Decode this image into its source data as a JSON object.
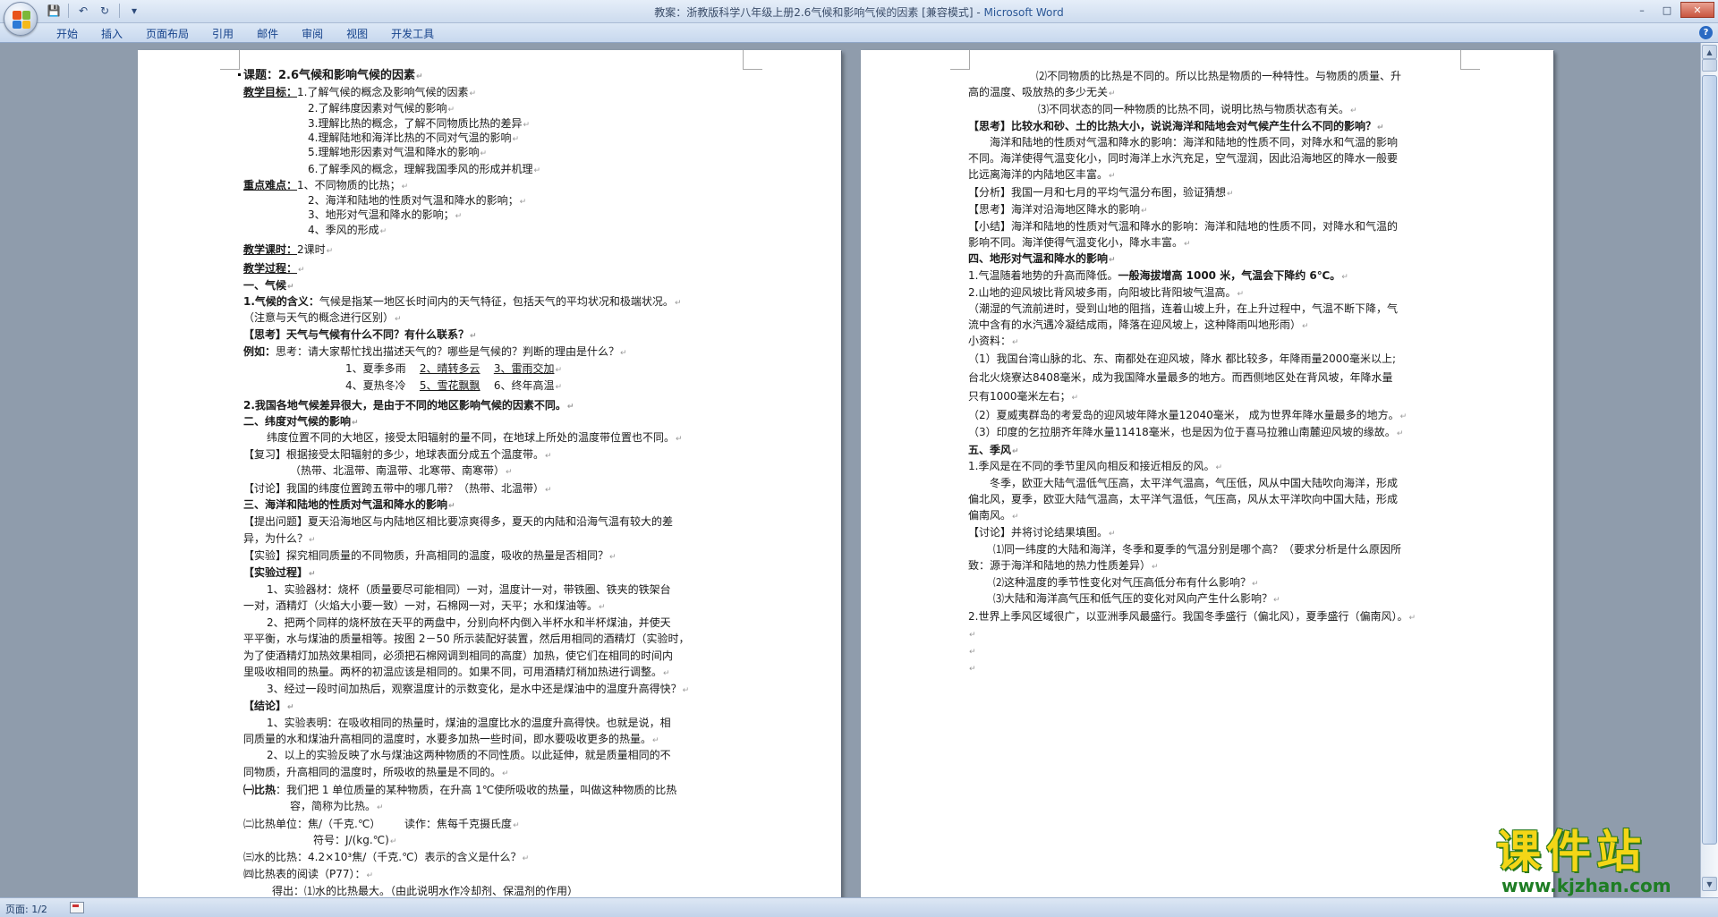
{
  "window": {
    "title": "教案：浙教版科学八年级上册2.6气候和影响气候的因素 [兼容模式] - ",
    "app_name": "Microsoft Word"
  },
  "quick_access": {
    "save": "💾",
    "undo": "↶",
    "redo": "↻",
    "more": "▾"
  },
  "window_controls": {
    "minimize": "–",
    "maximize": "□",
    "close": "✕"
  },
  "ribbon": {
    "tabs": [
      "开始",
      "插入",
      "页面布局",
      "引用",
      "邮件",
      "审阅",
      "视图",
      "开发工具"
    ],
    "help": "?"
  },
  "status_bar": {
    "page": "页面: 1/2"
  },
  "scrollbar": {
    "up": "▲",
    "down": "▼"
  },
  "watermark": {
    "title": "课件站",
    "url": "www.kjzhan.com"
  },
  "pilcrow": "↵",
  "page1": {
    "title": "课题：2.6气候和影响气候的因素",
    "goals_label": "教学目标：",
    "goals": [
      "1.了解气候的概念及影响气候的因素",
      "2.了解纬度因素对气候的影响",
      "3.理解比热的概念，了解不同物质比热的差异",
      "4.理解陆地和海洋比热的不同对气温的影响",
      "5.理解地形因素对气温和降水的影响",
      "6.了解季风的概念，理解我国季风的形成并机理"
    ],
    "key_label": "重点难点：",
    "keys": [
      "1、不同物质的比热；",
      "2、海洋和陆地的性质对气温和降水的影响；",
      "3、地形对气温和降水的影响；",
      "4、季风的形成"
    ],
    "hours_label": "教学课时：",
    "hours_value": "2课时",
    "process_label": "教学过程：",
    "s1_head": "一、气候",
    "climate_def_label": "1.气候的含义：",
    "climate_def": "气候是指某一地区长时间内的天气特征，包括天气的平均状况和极端状况。",
    "climate_note": "（注意与天气的概念进行区别）",
    "think1": "【思考】天气与气候有什么不同？有什么联系？",
    "example_label": "例如：",
    "example_text": "思考：请大家帮忙找出描述天气的？哪些是气候的？判断的理由是什么？",
    "ex_row1": {
      "a": "1、夏季多雨",
      "b": "2、晴转多云",
      "c": "3、雷雨交加"
    },
    "ex_row2": {
      "a": "4、夏热冬冷",
      "b": "5、雪花飘飘",
      "c": "6、终年高温"
    },
    "climate_diff": "2.我国各地气候差异很大，是由于不同的地区影响气候的因素不同。",
    "s2_head": "二、纬度对气候的影响",
    "s2_text": "纬度位置不同的大地区，接受太阳辐射的量不同，在地球上所处的温度带位置也不同。",
    "review": "【复习】根据接受太阳辐射的多少，地球表面分成五个温度带。",
    "zones": "（热带、北温带、南温带、北寒带、南寒带）",
    "discuss1": "【讨论】我国的纬度位置跨五带中的哪几带？（热带、北温带）",
    "s3_head": "三、海洋和陆地的性质对气温和降水的影响",
    "question_l1": "【提出问题】夏天沿海地区与内陆地区相比要凉爽得多，夏天的内陆和沿海气温有较大的差",
    "question_l2": "异，为什么？",
    "experiment": "【实验】探究相同质量的不同物质，升高相同的温度，吸收的热量是否相同？",
    "process_head": "【实验过程】",
    "step1_l1": "1、实验器材：烧杯（质量要尽可能相同）一对，温度计一对，带铁圈、铁夹的铁架台",
    "step1_l2": "一对，酒精灯（火焰大小要一致）一对，石棉网一对，天平；水和煤油等。",
    "step2_l1": "2、把两个同样的烧杯放在天平的两盘中，分别向杯内倒入半杯水和半杯煤油，并使天",
    "step2_l2": "平平衡，水与煤油的质量相等。按图 2－50 所示装配好装置，然后用相同的酒精灯（实验时，",
    "step2_l3": "为了使酒精灯加热效果相同，必须把石棉网调到相同的高度）加热，使它们在相同的时间内",
    "step2_l4": "里吸收相同的热量。两杯的初温应该是相同的。如果不同，可用酒精灯稍加热进行调整。",
    "step3": "3、经过一段时间加热后，观察温度计的示数变化，是水中还是煤油中的温度升高得快？",
    "conclusion_head": "【结论】",
    "concl1_l1": "1、实验表明：在吸收相同的热量时，煤油的温度比水的温度升高得快。也就是说，相",
    "concl1_l2": "同质量的水和煤油升高相同的温度时，水要多加热一些时间，即水要吸收更多的热量。",
    "concl2_l1": "2、以上的实验反映了水与煤油这两种物质的不同性质。以此延伸，就是质量相同的不",
    "concl2_l2": "同物质，升高相同的温度时，所吸收的热量是不同的。",
    "sh_def_label": "㈠比热",
    "sh_def_l1": "：我们把 1 单位质量的某种物质，在升高 1℃使所吸收的热量，叫做这种物质的比热",
    "sh_def_l2": "容，简称为比热。",
    "sh_unit": "㈡比热单位：焦/（千克.℃）",
    "sh_unit_read": "读作：焦每千克摄氏度",
    "sh_symbol": "符号：J/(kg.℃)",
    "sh_water": "㈢水的比热：4.2×10³焦/（千克.℃）表示的含义是什么？",
    "sh_table": "㈣比热表的阅读（P77）：",
    "sh_result": "得出：⑴水的比热最大。（由此说明水作冷却剂、保温剂的作用）"
  },
  "page2": {
    "p2_l1": "⑵不同物质的比热是不同的。所以比热是物质的一种特性。与物质的质量、升",
    "p2_l2": "高的温度、吸放热的多少无关",
    "p2_l3": "⑶不同状态的同一种物质的比热不同，说明比热与物质状态有关。",
    "think2": "【思考】比较水和砂、土的比热大小，说说海洋和陆地会对气候产生什么不同的影响？",
    "think2_a1": "海洋和陆地的性质对气温和降水的影响：海洋和陆地的性质不同，对降水和气温的影响",
    "think2_a2": "不同。海洋使得气温变化小，同时海洋上水汽充足，空气湿润，因此沿海地区的降水一般要",
    "think2_a3": "比远离海洋的内陆地区丰富。",
    "analysis": "【分析】我国一月和七月的平均气温分布图，验证猜想",
    "think3": "【思考】海洋对沿海地区降水的影响",
    "summary_l1": "【小结】海洋和陆地的性质对气温和降水的影响：海洋和陆地的性质不同，对降水和气温的",
    "summary_l2": "影响不同。海洋使得气温变化小，降水丰富。",
    "s4_head": "四、地形对气温和降水的影响",
    "terrain1_a": "1.气温随着地势的升高而降低。",
    "terrain1_b": "一般海拔增高 1000 米，气温会下降约 6℃。",
    "terrain2": "2.山地的迎风坡比背风坡多雨，向阳坡比背阳坡气温高。",
    "terrain2_e1": "（潮湿的气流前进时，受到山地的阻挡，连着山坡上升，在上升过程中，气温不断下降，气",
    "terrain2_e2": "流中含有的水汽遇冷凝结成雨，降落在迎风坡上，这种降雨叫地形雨）",
    "info_label": "小资料：",
    "info1_l1": "（1）我国台湾山脉的北、东、南都处在迎风坡，降水 都比较多，年降雨量2000毫米以上;",
    "info1_l2": "台北火烧寮达8408毫米，成为我国降水量最多的地方。而西侧地区处在背风坡，年降水量",
    "info1_l3": "只有1000毫米左右；",
    "info2": "（2）夏威夷群岛的考爱岛的迎风坡年降水量12040毫米， 成为世界年降水量最多的地方。",
    "info3": "（3）印度的乞拉朋齐年降水量11418毫米，也是因为位于喜马拉雅山南麓迎风坡的缘故。",
    "s5_head": "五、季风",
    "monsoon1": "1.季风是在不同的季节里风向相反和接近相反的风。",
    "monsoon_w1": "冬季，欧亚大陆气温低气压高，太平洋气温高，气压低，风从中国大陆吹向海洋，形成",
    "monsoon_w2": "偏北风，夏季，欧亚大陆气温高，太平洋气温低，气压高，风从太平洋吹向中国大陆，形成",
    "monsoon_w3": "偏南风。",
    "discuss2": "【讨论】并将讨论结果填图。",
    "q1_l1": "⑴同一纬度的大陆和海洋，冬季和夏季的气温分别是哪个高？（要求分析是什么原因所",
    "q1_l2": "致：源于海洋和陆地的热力性质差异）",
    "q2": "⑵这种温度的季节性变化对气压高低分布有什么影响？",
    "q3": "⑶大陆和海洋高气压和低气压的变化对风向产生什么影响？",
    "monsoon2": "2.世界上季风区域很广，以亚洲季风最盛行。我国冬季盛行（偏北风），夏季盛行（偏南风）。"
  }
}
